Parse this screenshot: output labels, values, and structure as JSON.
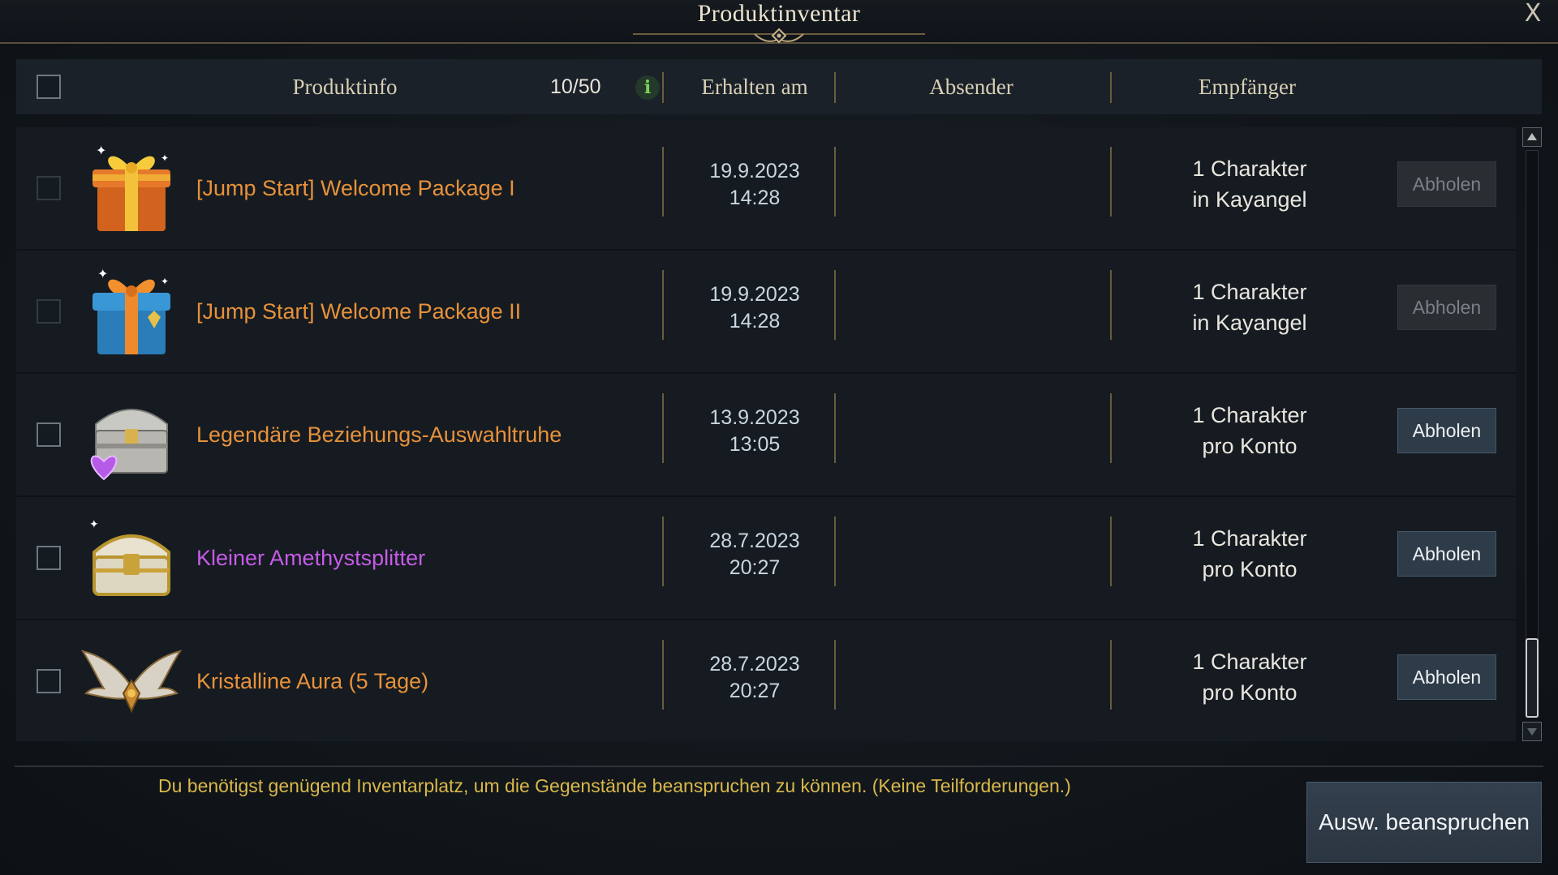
{
  "window": {
    "title": "Produktinventar",
    "close_label": "X"
  },
  "header": {
    "product_info": "Produktinfo",
    "count": "10/50",
    "info_glyph": "i",
    "received": "Erhalten am",
    "sender": "Absender",
    "recipient": "Empfänger"
  },
  "rows": [
    {
      "name": "[Jump Start] Welcome Package I",
      "name_color": "orange",
      "icon": "gift-orange-icon",
      "date": "19.9.2023",
      "time": "14:28",
      "sender": "",
      "recipient_line1": "1 Charakter",
      "recipient_line2": "in Kayangel",
      "claim": "Abholen",
      "claim_enabled": false
    },
    {
      "name": "[Jump Start] Welcome Package II",
      "name_color": "orange",
      "icon": "gift-blue-icon",
      "date": "19.9.2023",
      "time": "14:28",
      "sender": "",
      "recipient_line1": "1 Charakter",
      "recipient_line2": "in Kayangel",
      "claim": "Abholen",
      "claim_enabled": false
    },
    {
      "name": "Legendäre Beziehungs-Auswahltruhe",
      "name_color": "orange",
      "icon": "chest-heart-icon",
      "date": "13.9.2023",
      "time": "13:05",
      "sender": "",
      "recipient_line1": "1 Charakter",
      "recipient_line2": "pro Konto",
      "claim": "Abholen",
      "claim_enabled": true
    },
    {
      "name": "Kleiner Amethystsplitter",
      "name_color": "purple",
      "icon": "gold-chest-icon",
      "date": "28.7.2023",
      "time": "20:27",
      "sender": "",
      "recipient_line1": "1 Charakter",
      "recipient_line2": "pro Konto",
      "claim": "Abholen",
      "claim_enabled": true
    },
    {
      "name": "Kristalline Aura (5 Tage)",
      "name_color": "orange",
      "icon": "wings-icon",
      "date": "28.7.2023",
      "time": "20:27",
      "sender": "",
      "recipient_line1": "1 Charakter",
      "recipient_line2": "pro Konto",
      "claim": "Abholen",
      "claim_enabled": true
    }
  ],
  "footer": {
    "notice": "Du benötigst genügend Inventarplatz, um die Gegenstände beanspruchen zu können. (Keine Teilforderungen.)",
    "claim_selected": "Ausw. beanspruchen"
  },
  "colors": {
    "accent_orange": "#e8913a",
    "accent_purple": "#c65be6",
    "notice_yellow": "#d9b84a",
    "divider_gold": "#6b5c3e"
  }
}
